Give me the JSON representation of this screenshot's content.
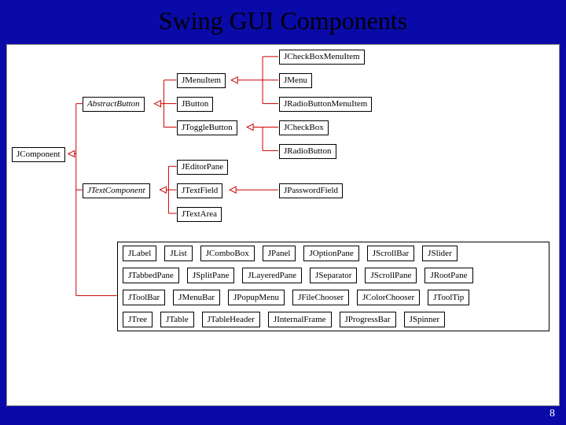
{
  "title": "Swing GUI Components",
  "page_number": "8",
  "hierarchy": {
    "root": "JComponent",
    "abstract_button": "AbstractButton",
    "jmenu_item": "JMenuItem",
    "jbutton": "JButton",
    "jtoggle_button": "JToggleButton",
    "jcheckbox_menuitem": "JCheckBoxMenuItem",
    "jmenu": "JMenu",
    "jradiobutton_menuitem": "JRadioButtonMenuItem",
    "jcheckbox": "JCheckBox",
    "jradiobutton": "JRadioButton",
    "jtext_component": "JTextComponent",
    "jeditorpane": "JEditorPane",
    "jtextfield": "JTextField",
    "jtextarea": "JTextArea",
    "jpasswordfield": "JPasswordField"
  },
  "grid": {
    "rows": [
      [
        "JLabel",
        "JList",
        "JComboBox",
        "JPanel",
        "JOptionPane",
        "JScrollBar",
        "JSlider"
      ],
      [
        "JTabbedPane",
        "JSplitPane",
        "JLayeredPane",
        "JSeparator",
        "JScrollPane",
        "JRootPane"
      ],
      [
        "JToolBar",
        "JMenuBar",
        "JPopupMenu",
        "JFileChooser",
        "JColorChooser",
        "JToolTip"
      ],
      [
        "JTree",
        "JTable",
        "JTableHeader",
        "JInternalFrame",
        "JProgressBar",
        "JSpinner"
      ]
    ]
  }
}
